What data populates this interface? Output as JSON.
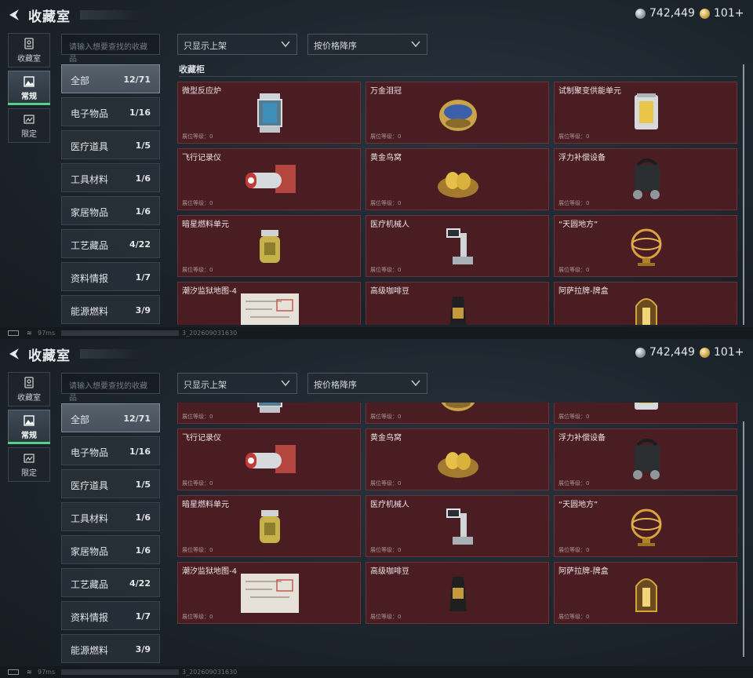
{
  "header": {
    "title": "收藏室",
    "silver_amount": "742,449",
    "gold_amount": "101+"
  },
  "catnav": [
    {
      "label": "收藏室",
      "icon": "collection-icon",
      "active": false
    },
    {
      "label": "常规",
      "icon": "photo-icon",
      "active": true
    },
    {
      "label": "限定",
      "icon": "limited-icon",
      "active": false
    }
  ],
  "search": {
    "placeholder": "请输入想要查找的收藏品"
  },
  "filters": {
    "shelf": "只显示上架",
    "sort": "按价格降序"
  },
  "subcategories": [
    {
      "name": "全部",
      "count": "12/71",
      "active": true
    },
    {
      "name": "电子物品",
      "count": "1/16"
    },
    {
      "name": "医疗道具",
      "count": "1/5"
    },
    {
      "name": "工具材料",
      "count": "1/6"
    },
    {
      "name": "家居物品",
      "count": "1/6"
    },
    {
      "name": "工艺藏品",
      "count": "4/22"
    },
    {
      "name": "资料情报",
      "count": "1/7"
    },
    {
      "name": "能源燃料",
      "count": "3/9"
    }
  ],
  "section_title": "收藏柜",
  "slot_level_label": "展位等级：0",
  "items": [
    {
      "name": "微型反应炉",
      "icon": "reactor-icon"
    },
    {
      "name": "万金泪冠",
      "icon": "jeweled-egg-icon"
    },
    {
      "name": "试制聚变供能单元",
      "icon": "fusion-unit-icon"
    },
    {
      "name": "飞行记录仪",
      "icon": "flight-recorder-icon"
    },
    {
      "name": "黄金鸟窝",
      "icon": "golden-nest-icon"
    },
    {
      "name": "浮力补偿设备",
      "icon": "buoyancy-device-icon"
    },
    {
      "name": "暗星燃料单元",
      "icon": "fuel-canister-icon"
    },
    {
      "name": "医疗机械人",
      "icon": "medical-robot-icon"
    },
    {
      "name": "“天圆地方”",
      "icon": "armillary-sphere-icon"
    },
    {
      "name": "潮汐监狱地图-4",
      "icon": "prison-map-icon"
    },
    {
      "name": "高级咖啡豆",
      "icon": "coffee-bag-icon"
    },
    {
      "name": "阿萨拉牌-牌盒",
      "icon": "card-box-icon"
    }
  ],
  "status": {
    "ping": "97ms",
    "version": "3_202609031630"
  },
  "colors": {
    "card_bg": "#4a1d22",
    "active_green": "#4fd38c",
    "bg": "#1c242c"
  }
}
